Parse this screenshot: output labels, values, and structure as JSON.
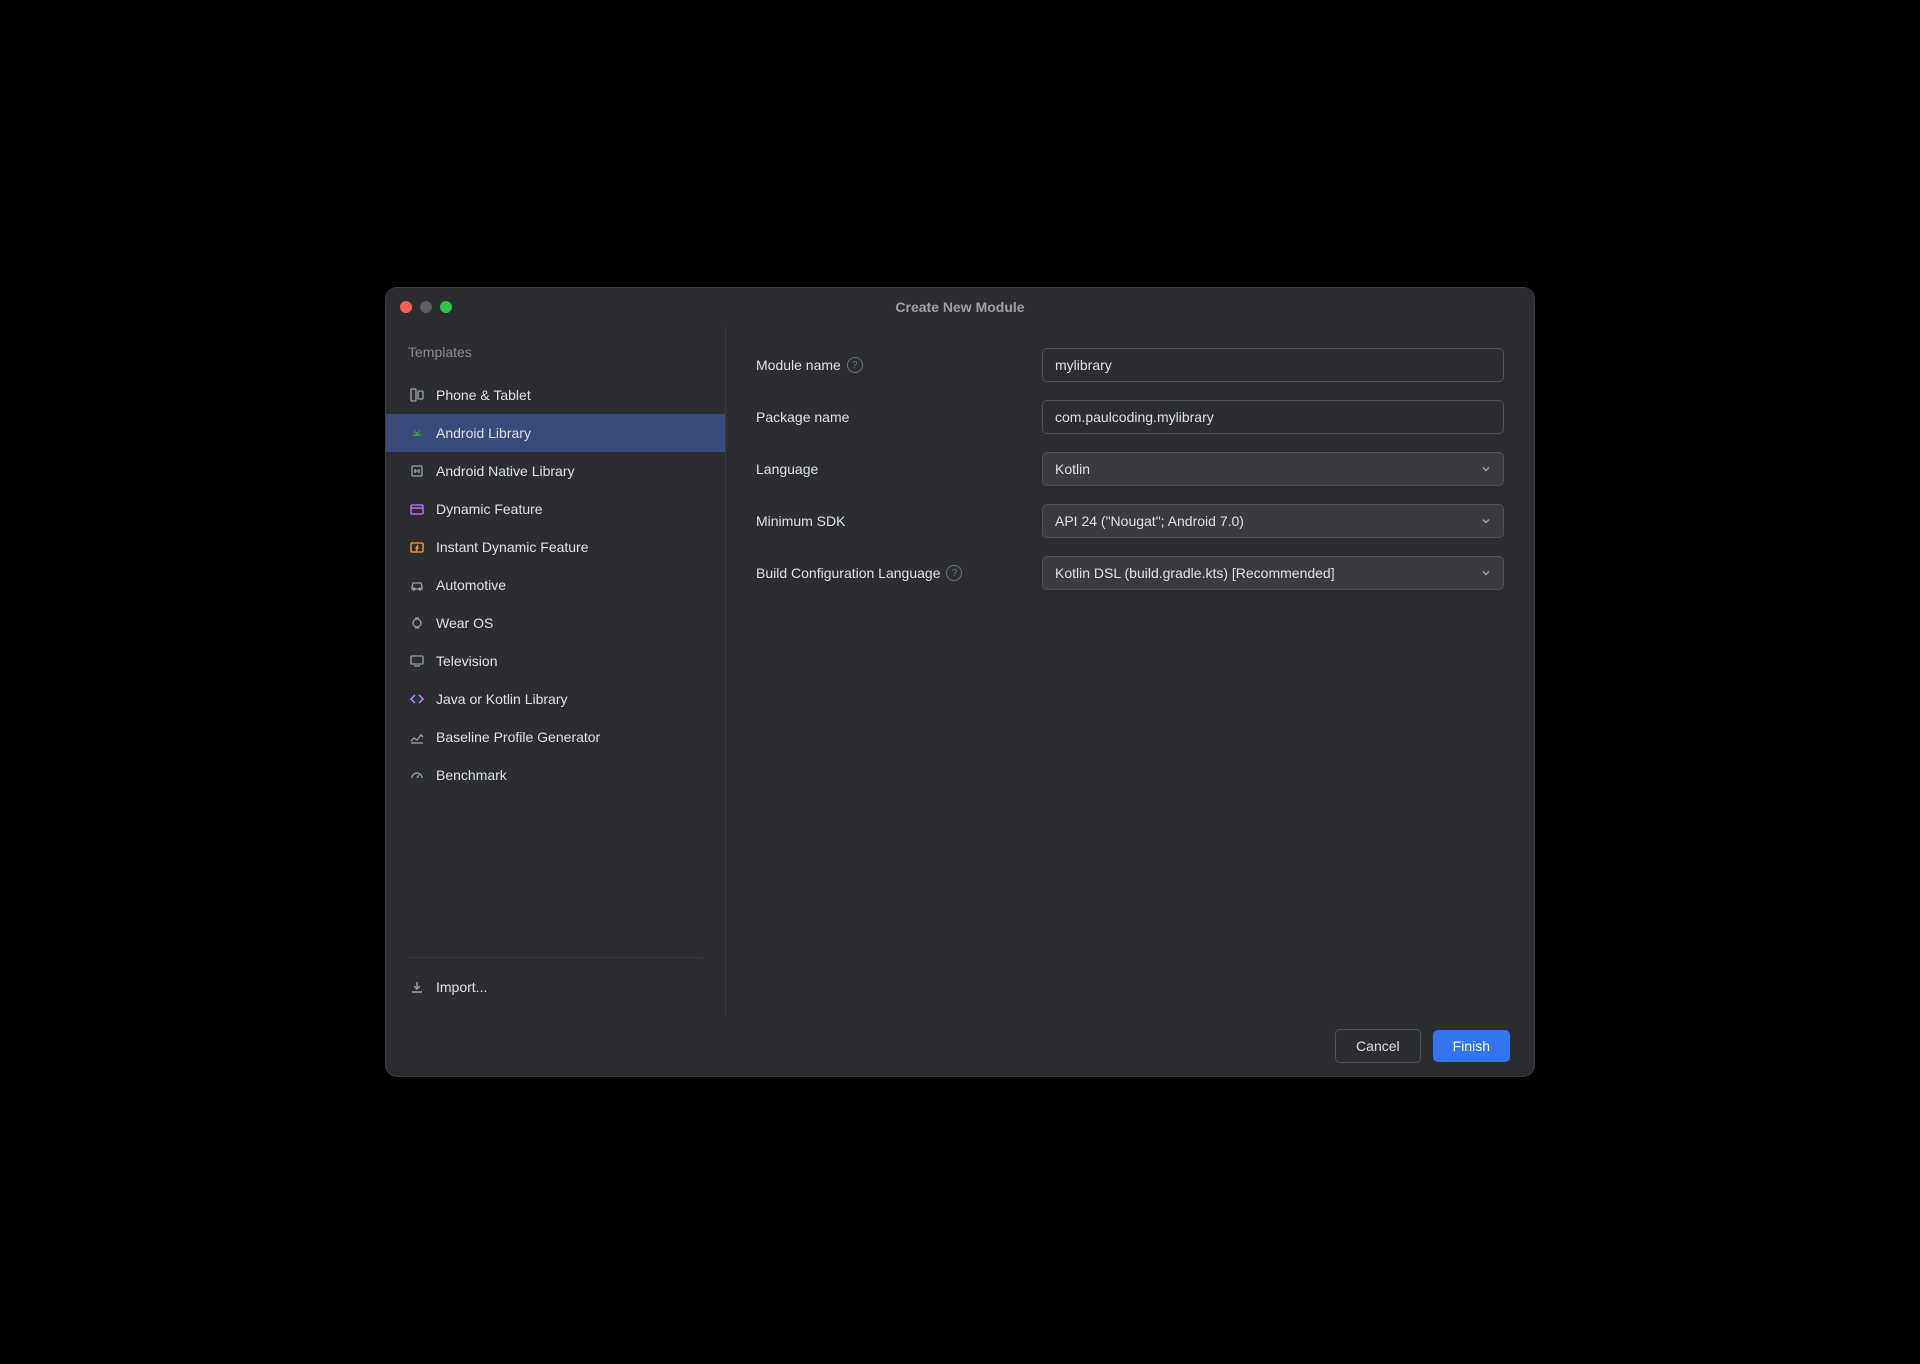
{
  "window": {
    "title": "Create New Module"
  },
  "sidebar": {
    "header": "Templates",
    "items": [
      {
        "label": "Phone & Tablet",
        "icon": "phone-tablet-icon",
        "selected": false
      },
      {
        "label": "Android Library",
        "icon": "android-icon",
        "selected": true,
        "iconColor": "#43a047"
      },
      {
        "label": "Android Native Library",
        "icon": "native-lib-icon",
        "selected": false
      },
      {
        "label": "Dynamic Feature",
        "icon": "dynamic-feature-icon",
        "selected": false,
        "iconColor": "#c77dff"
      },
      {
        "label": "Instant Dynamic Feature",
        "icon": "instant-dynamic-icon",
        "selected": false,
        "iconColor": "#ffa726"
      },
      {
        "label": "Automotive",
        "icon": "car-icon",
        "selected": false
      },
      {
        "label": "Wear OS",
        "icon": "watch-icon",
        "selected": false
      },
      {
        "label": "Television",
        "icon": "tv-icon",
        "selected": false
      },
      {
        "label": "Java or Kotlin Library",
        "icon": "code-icon",
        "selected": false,
        "iconColor": "#c77dff"
      },
      {
        "label": "Baseline Profile Generator",
        "icon": "baseline-icon",
        "selected": false
      },
      {
        "label": "Benchmark",
        "icon": "gauge-icon",
        "selected": false
      }
    ],
    "import_label": "Import..."
  },
  "form": {
    "module_name": {
      "label": "Module name",
      "value": "mylibrary",
      "help": true
    },
    "package_name": {
      "label": "Package name",
      "value": "com.paulcoding.mylibrary",
      "help": false
    },
    "language": {
      "label": "Language",
      "value": "Kotlin"
    },
    "min_sdk": {
      "label": "Minimum SDK",
      "value": "API 24 (\"Nougat\"; Android 7.0)"
    },
    "build_config": {
      "label": "Build Configuration Language",
      "value": "Kotlin DSL (build.gradle.kts) [Recommended]",
      "help": true
    }
  },
  "footer": {
    "cancel": "Cancel",
    "finish": "Finish"
  }
}
